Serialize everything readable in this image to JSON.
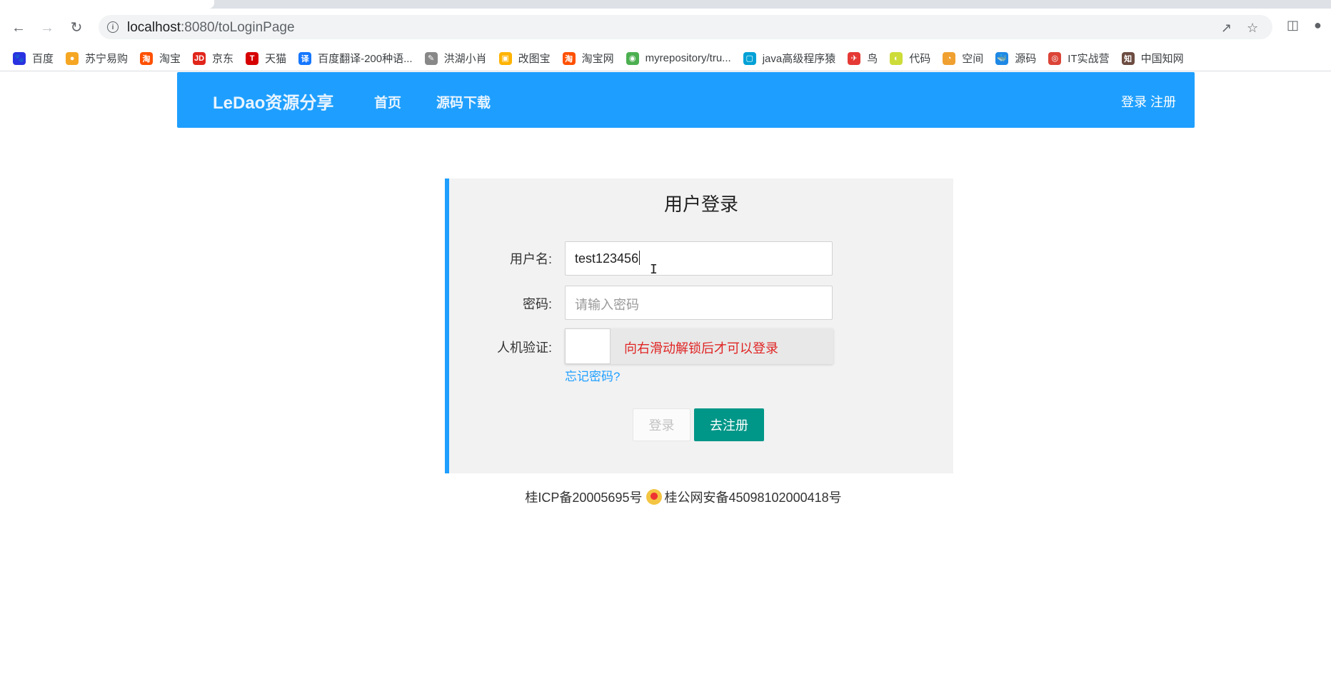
{
  "browser": {
    "url_host": "localhost",
    "url_path": ":8080/toLoginPage",
    "bookmarks": [
      {
        "label": "百度",
        "color": "#2932e1",
        "glyph": "🐾"
      },
      {
        "label": "苏宁易购",
        "color": "#f5a623",
        "glyph": "●"
      },
      {
        "label": "淘宝",
        "color": "#ff5000",
        "glyph": "淘"
      },
      {
        "label": "京东",
        "color": "#e1251b",
        "glyph": "JD"
      },
      {
        "label": "天猫",
        "color": "#d60000",
        "glyph": "T"
      },
      {
        "label": "百度翻译-200种语...",
        "color": "#1677ff",
        "glyph": "译"
      },
      {
        "label": "洪湖小肖",
        "color": "#888888",
        "glyph": "✎"
      },
      {
        "label": "改图宝",
        "color": "#ffb300",
        "glyph": "▣"
      },
      {
        "label": "淘宝网",
        "color": "#ff5000",
        "glyph": "淘"
      },
      {
        "label": "myrepository/tru...",
        "color": "#4caf50",
        "glyph": "◉"
      },
      {
        "label": "java高级程序猿",
        "color": "#00a1d6",
        "glyph": "▢"
      },
      {
        "label": "鸟",
        "color": "#e53935",
        "glyph": "✈"
      },
      {
        "label": "代码",
        "color": "#cddc39",
        "glyph": "◐"
      },
      {
        "label": "空间",
        "color": "#f0a030",
        "glyph": "◔"
      },
      {
        "label": "源码",
        "color": "#1e88e5",
        "glyph": "🐳"
      },
      {
        "label": "IT实战营",
        "color": "#db4437",
        "glyph": "◎"
      },
      {
        "label": "中国知网",
        "color": "#6d4c41",
        "glyph": "知"
      }
    ]
  },
  "header": {
    "brand": "LeDao资源分享",
    "nav": [
      "首页",
      "源码下载"
    ],
    "auth": "登录 注册",
    "color": "#1e9fff"
  },
  "login": {
    "title": "用户登录",
    "username_label": "用户名:",
    "username_value": "test123456",
    "password_label": "密码:",
    "password_placeholder": "请输入密码",
    "captcha_label": "人机验证:",
    "slider_text": "向右滑动解锁后才可以登录",
    "forgot": "忘记密码?",
    "login_button": "登录",
    "register_button": "去注册",
    "register_color": "#009688"
  },
  "footer": {
    "icp": "桂ICP备20005695号",
    "police": "桂公网安备45098102000418号"
  }
}
